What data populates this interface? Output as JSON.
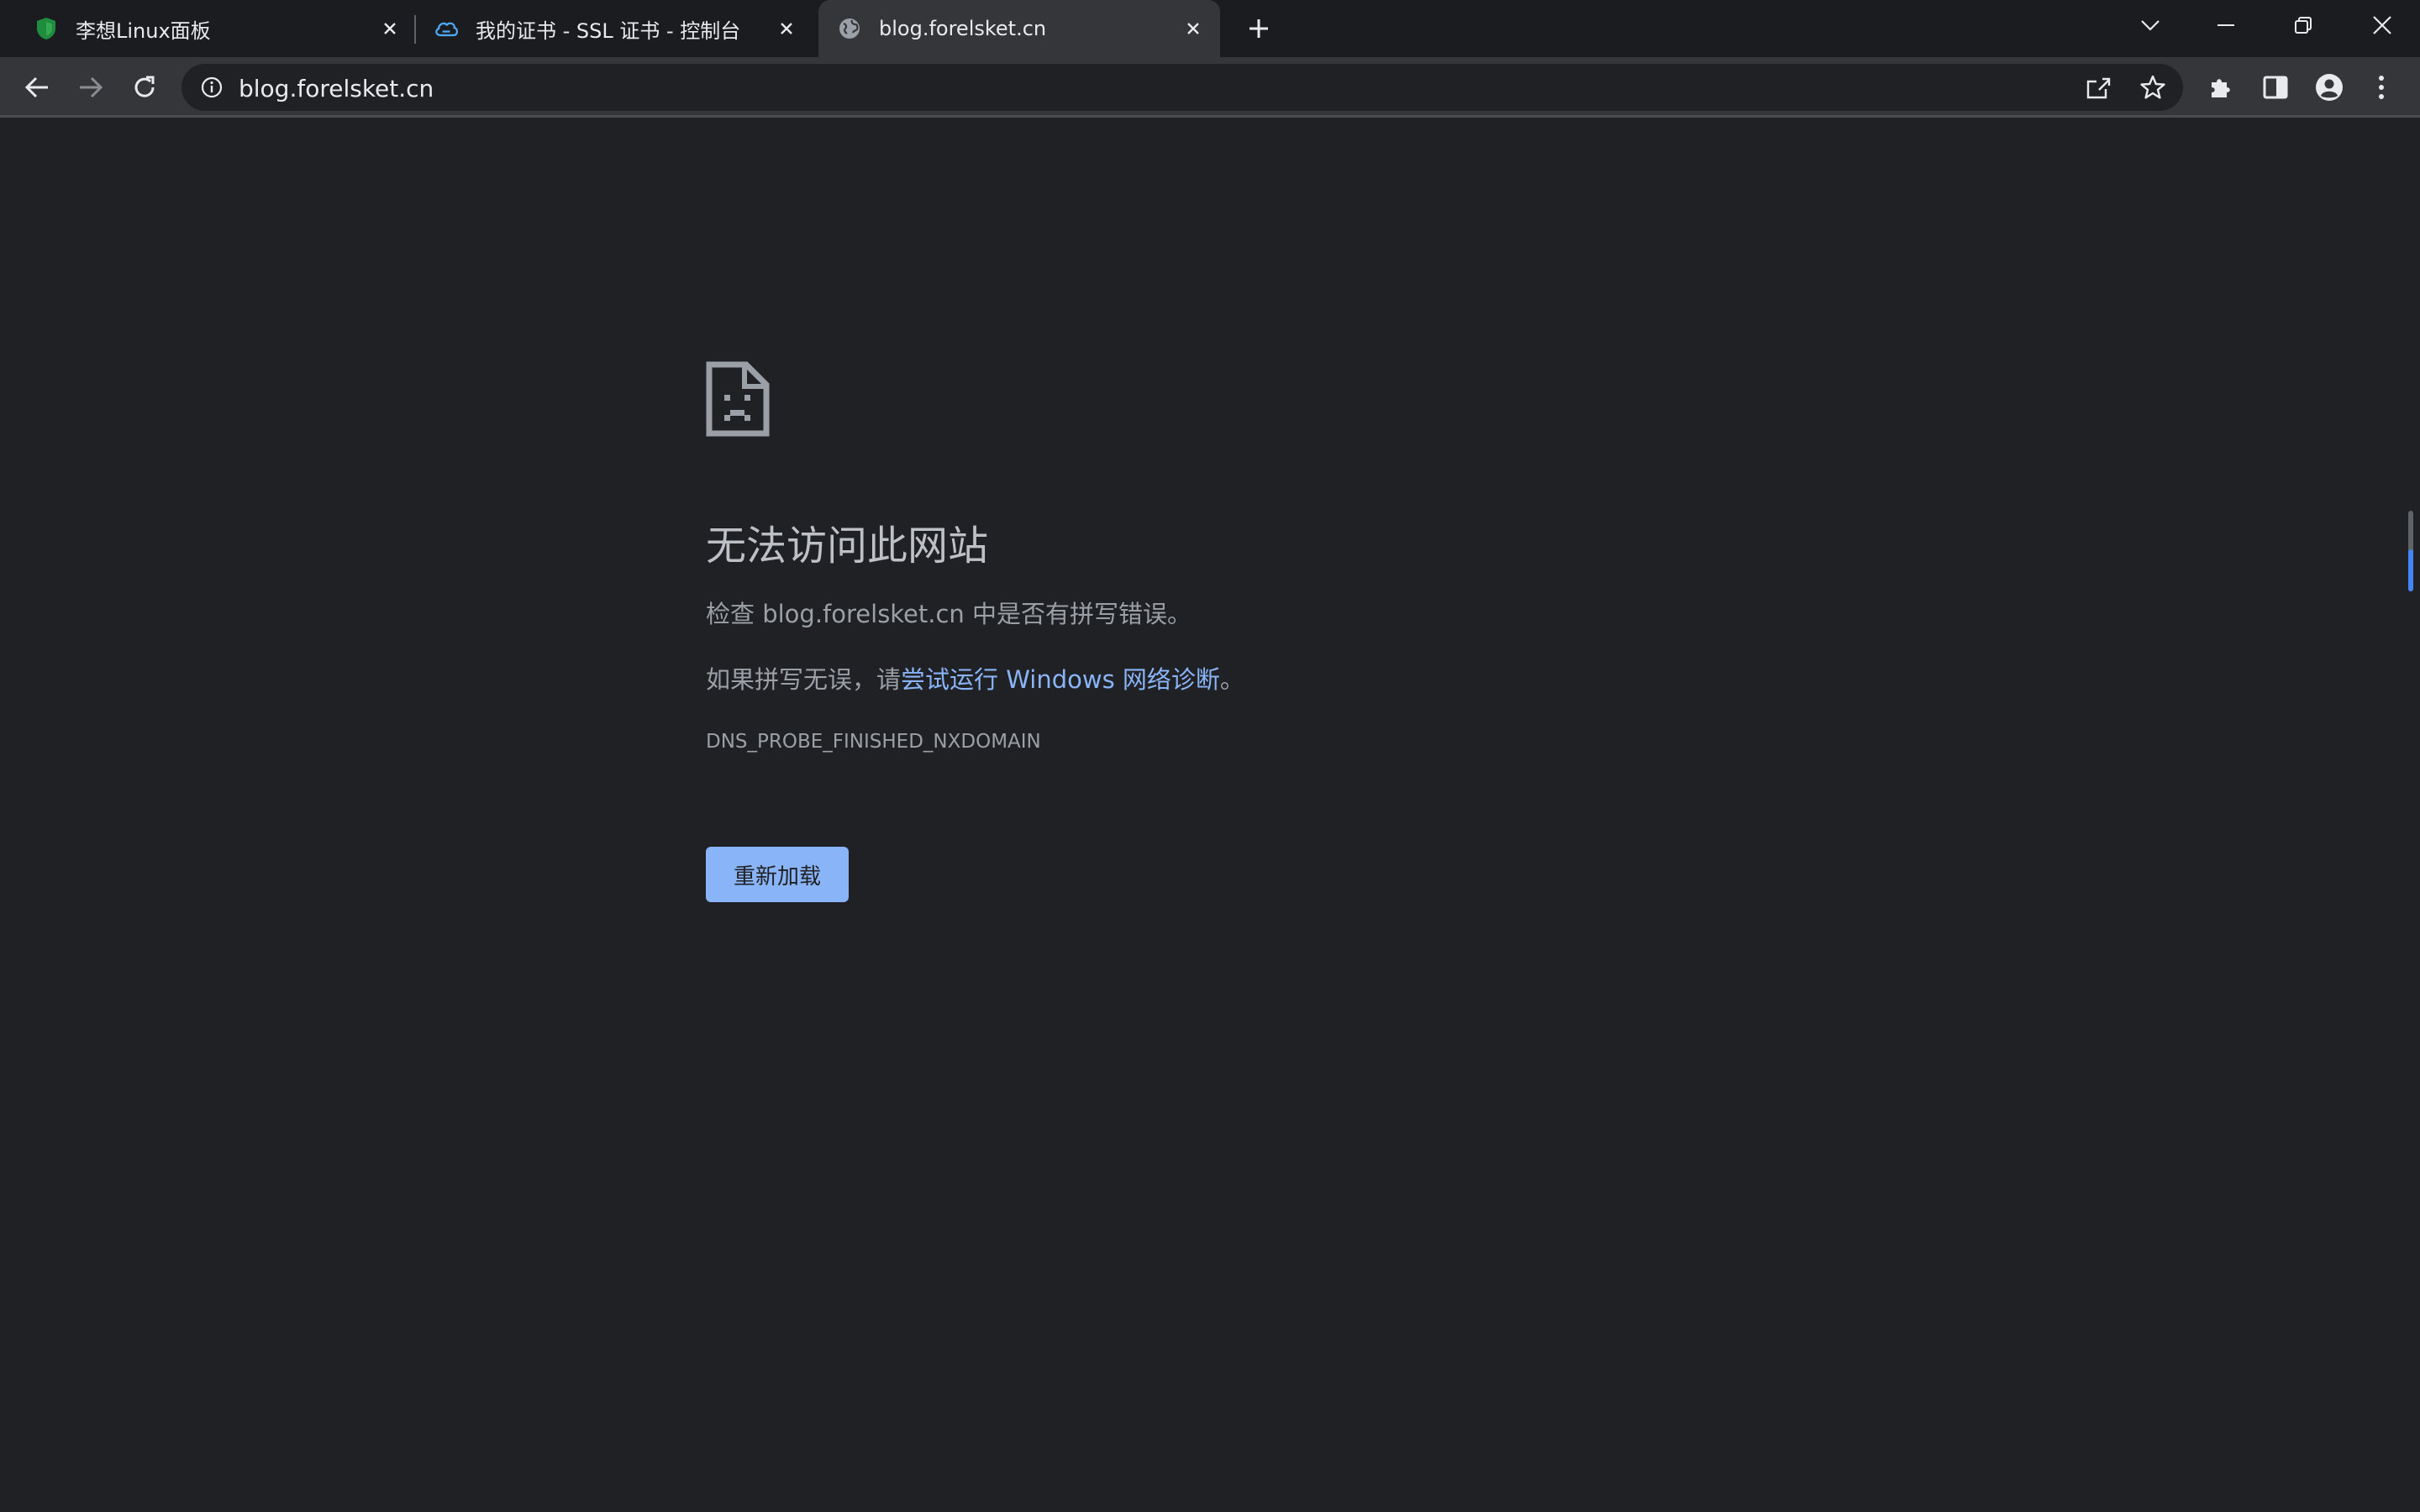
{
  "tabs": [
    {
      "title": "李想Linux面板",
      "icon": "shield-icon",
      "active": false
    },
    {
      "title": "我的证书 - SSL 证书 - 控制台",
      "icon": "cloud-icon",
      "active": false
    },
    {
      "title": "blog.forelsket.cn",
      "icon": "globe-icon",
      "active": true
    }
  ],
  "toolbar": {
    "url": "blog.forelsket.cn"
  },
  "error": {
    "heading": "无法访问此网站",
    "line1": "检查 blog.forelsket.cn 中是否有拼写错误。",
    "line2_prefix": "如果拼写无误，请",
    "line2_link": "尝试运行 Windows 网络诊断",
    "line2_suffix": "。",
    "code": "DNS_PROBE_FINISHED_NXDOMAIN",
    "reload_label": "重新加载"
  },
  "colors": {
    "accent": "#8ab4f8",
    "background": "#202124",
    "toolbar": "#35363a"
  }
}
